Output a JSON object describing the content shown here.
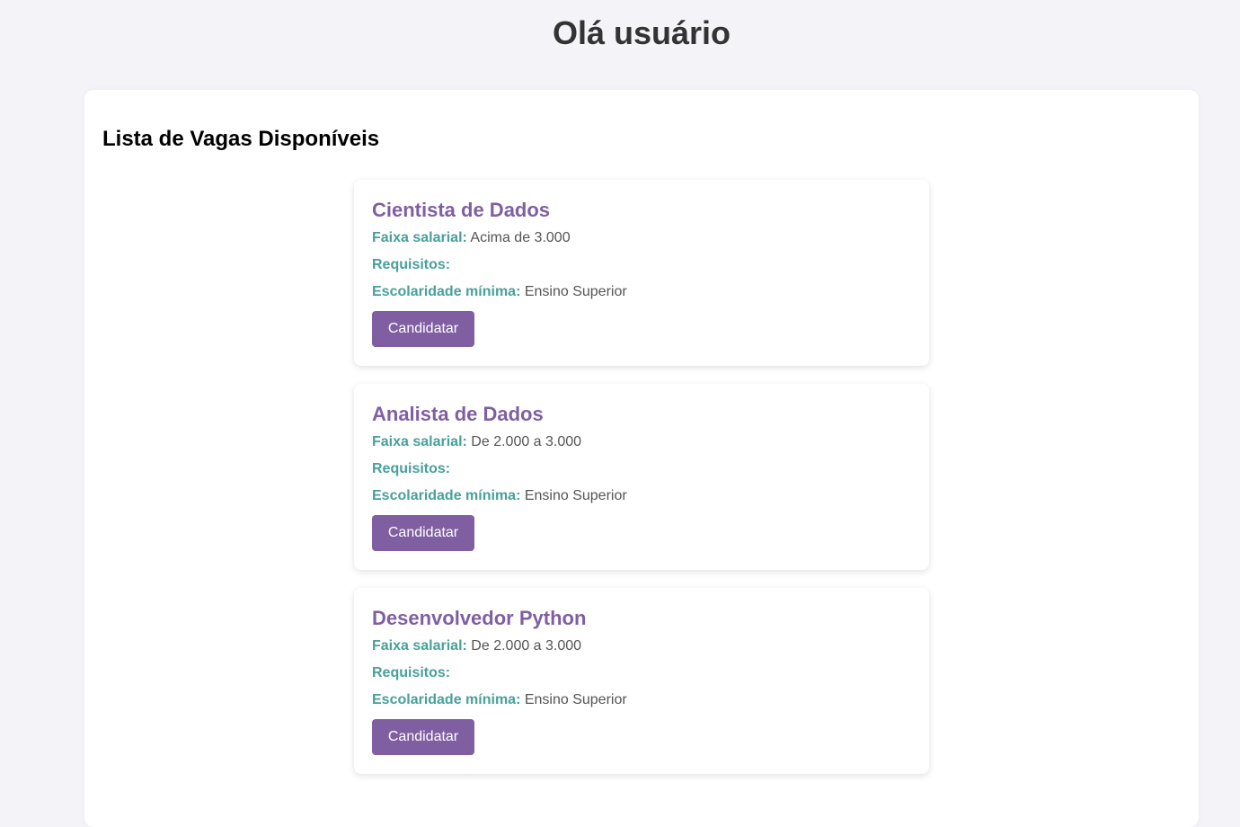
{
  "header": {
    "title": "Olá usuário"
  },
  "main": {
    "section_title": "Lista de Vagas Disponíveis",
    "labels": {
      "salary": "Faixa salarial:",
      "requirements": "Requisitos:",
      "education": "Escolaridade mínima:"
    },
    "jobs": [
      {
        "title": "Cientista de Dados",
        "salary": "Acima de 3.000",
        "requirements": "",
        "education": "Ensino Superior",
        "button_label": "Candidatar"
      },
      {
        "title": "Analista de Dados",
        "salary": "De 2.000 a 3.000",
        "requirements": "",
        "education": "Ensino Superior",
        "button_label": "Candidatar"
      },
      {
        "title": "Desenvolvedor Python",
        "salary": "De 2.000 a 3.000",
        "requirements": "",
        "education": "Ensino Superior",
        "button_label": "Candidatar"
      }
    ]
  },
  "colors": {
    "background": "#f3f3f8",
    "panel": "#ffffff",
    "accent_purple": "#7f5fa2",
    "label_teal": "#48a09a",
    "title_text": "#333333",
    "body_text": "#555555"
  }
}
